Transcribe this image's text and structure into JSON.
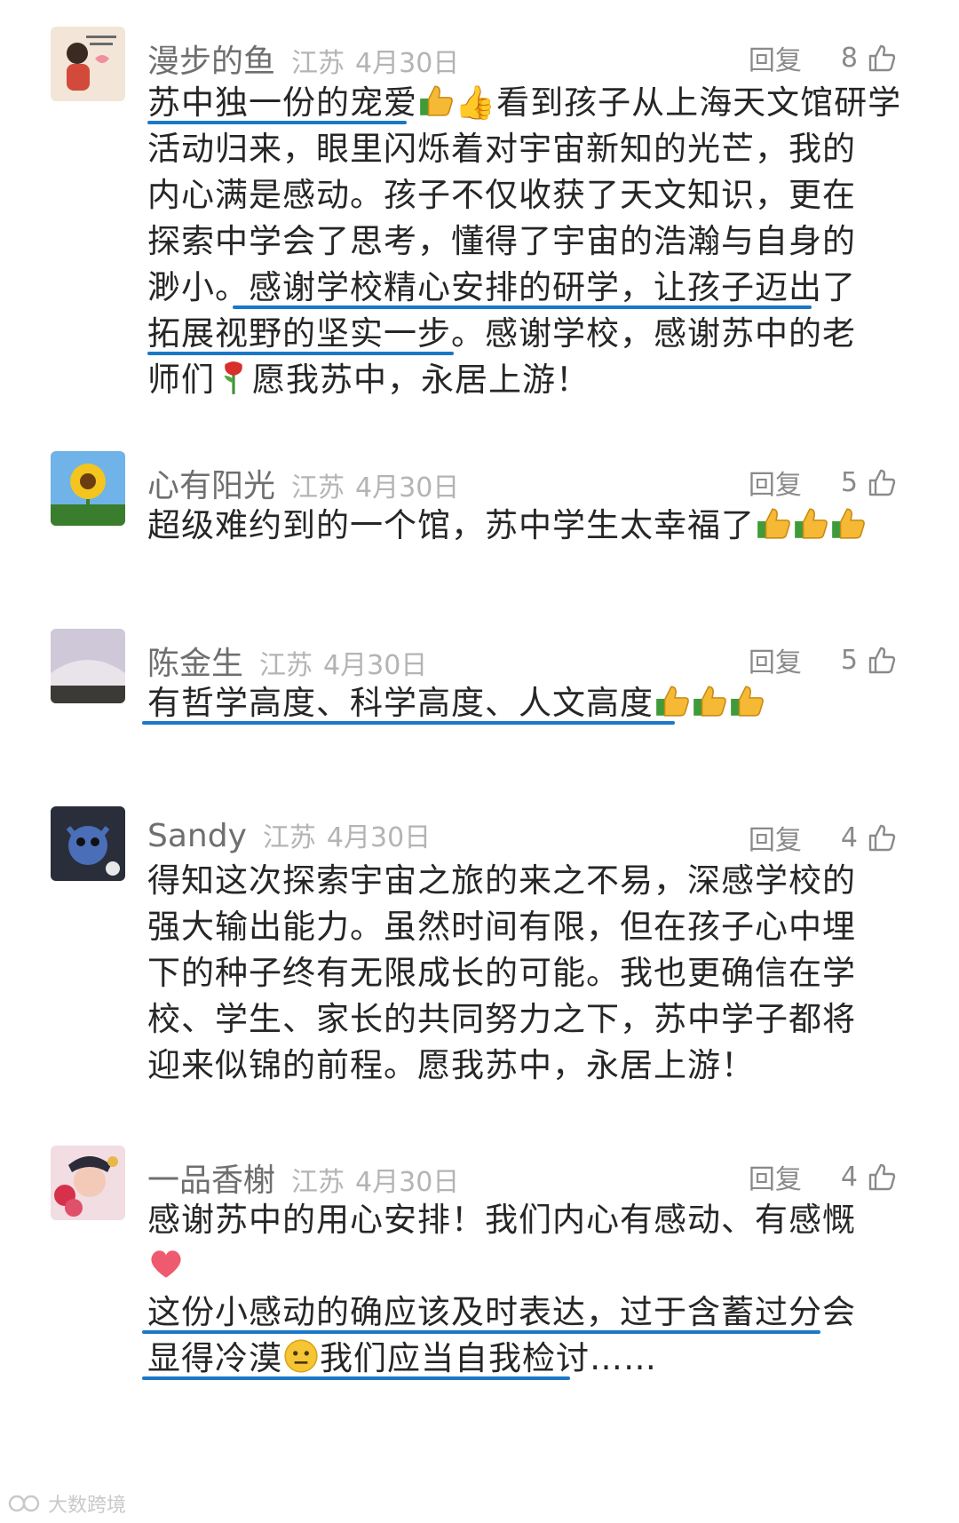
{
  "reply_label": "回复",
  "comments": [
    {
      "name": "漫步的鱼",
      "location": "江苏",
      "date": "4月30日",
      "likes": "8",
      "lines": [
        "苏中独一份的宠爱",
        "👍看到孩子从上海天文馆研学",
        "活动归来，眼里闪烁着对宇宙新知的光芒，我的",
        "内心满是感动。孩子不仅收获了天文知识，更在",
        "探索中学会了思考，懂得了宇宙的浩瀚与自身的",
        "渺小。感谢学校精心安排的研学，让孩子迈出了",
        "拓展视野的坚实一步。感谢学校，感谢苏中的老",
        "师们",
        "愿我苏中，永居上游！"
      ]
    },
    {
      "name": "心有阳光",
      "location": "江苏",
      "date": "4月30日",
      "likes": "5",
      "lines": [
        "超级难约到的一个馆，苏中学生太幸福了"
      ]
    },
    {
      "name": "陈金生",
      "location": "江苏",
      "date": "4月30日",
      "likes": "5",
      "lines": [
        "有哲学高度、科学高度、人文高度"
      ]
    },
    {
      "name": "Sandy",
      "location": "江苏",
      "date": "4月30日",
      "likes": "4",
      "lines": [
        "得知这次探索宇宙之旅的来之不易，深感学校的",
        "强大输出能力。虽然时间有限，但在孩子心中埋",
        "下的种子终有无限成长的可能。我也更确信在学",
        "校、学生、家长的共同努力之下，苏中学子都将",
        "迎来似锦的前程。愿我苏中，永居上游！"
      ]
    },
    {
      "name": "一品香榭",
      "location": "江苏",
      "date": "4月30日",
      "likes": "4",
      "lines": [
        "感谢苏中的用心安排！我们内心有感动、有感慨",
        "这份小感动的确应该及时表达，过于含蓄过分会",
        "显得冷漠",
        "我们应当自我检讨……"
      ]
    }
  ],
  "watermark": "大数跨境",
  "colors": {
    "underline": "#1a78c8",
    "name": "#6f6f6f",
    "meta": "#b4b4b4"
  }
}
